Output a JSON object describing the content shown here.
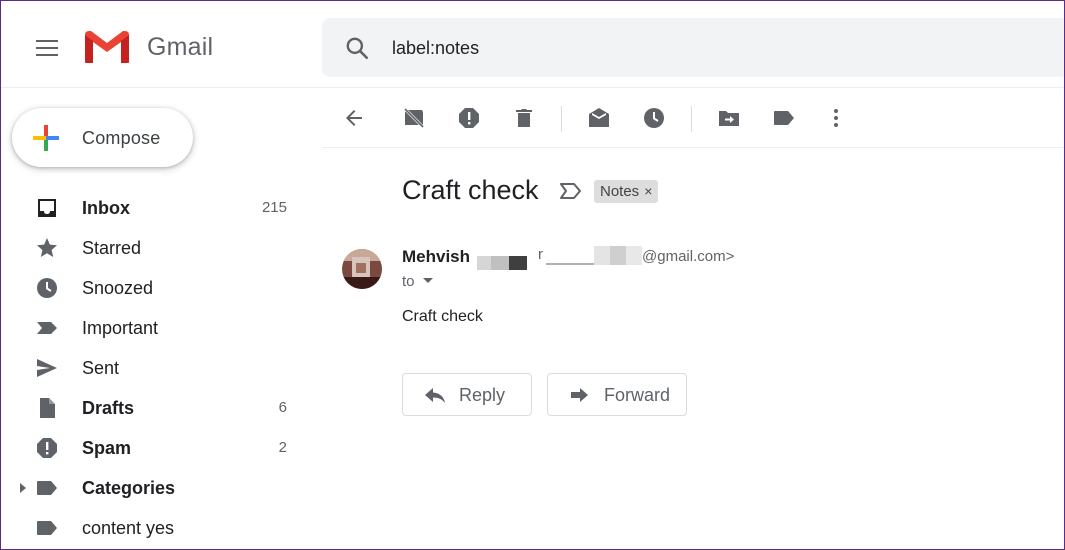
{
  "app": {
    "name": "Gmail"
  },
  "colors": {
    "red": "#ea4335",
    "blue": "#4285f4",
    "yellow": "#fbbc04",
    "green": "#34a853",
    "icon_gray": "#5f6368",
    "search_bg": "#f1f3f4"
  },
  "header": {
    "menu_icon": "hamburger-icon",
    "logo_icon": "gmail-m-logo",
    "logo_text": "Gmail",
    "search": {
      "icon": "search-icon",
      "value": "label:notes"
    }
  },
  "sidebar": {
    "compose_label": "Compose",
    "items": [
      {
        "label": "Inbox",
        "count": "215",
        "icon": "inbox-icon",
        "bold": true
      },
      {
        "label": "Starred",
        "count": "",
        "icon": "star-icon",
        "bold": false
      },
      {
        "label": "Snoozed",
        "count": "",
        "icon": "clock-icon",
        "bold": false
      },
      {
        "label": "Important",
        "count": "",
        "icon": "important-icon",
        "bold": false
      },
      {
        "label": "Sent",
        "count": "",
        "icon": "send-icon",
        "bold": false
      },
      {
        "label": "Drafts",
        "count": "6",
        "icon": "draft-icon",
        "bold": true
      },
      {
        "label": "Spam",
        "count": "2",
        "icon": "spam-icon",
        "bold": true
      },
      {
        "label": "Categories",
        "count": "",
        "icon": "label-icon",
        "bold": true
      },
      {
        "label": "content yes",
        "count": "",
        "icon": "label-icon",
        "bold": false
      }
    ]
  },
  "toolbar": {
    "buttons": [
      "back-arrow-icon",
      "archive-icon",
      "report-spam-icon",
      "delete-icon",
      "mark-unread-icon",
      "snooze-icon",
      "move-to-icon",
      "labels-icon",
      "more-vert-icon"
    ]
  },
  "message": {
    "subject": "Craft check",
    "label_chip": "Notes",
    "label_remove": "×",
    "sender_name": "Mehvish",
    "sender_email_prefix": "r",
    "sender_email_suffix": "@gmail.com>",
    "recipient": "to",
    "body": "Craft check",
    "reply_label": "Reply",
    "forward_label": "Forward"
  }
}
